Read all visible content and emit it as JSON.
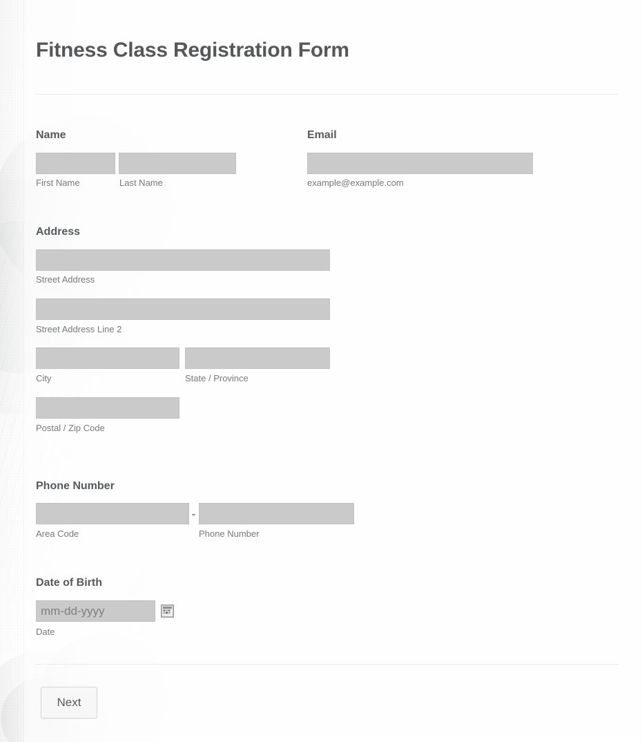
{
  "form": {
    "title": "Fitness Class Registration Form",
    "submit_label": "Next"
  },
  "fields": {
    "name": {
      "label": "Name",
      "first": {
        "sub_label": "First Name",
        "value": "",
        "placeholder": ""
      },
      "last": {
        "sub_label": "Last Name",
        "value": "",
        "placeholder": ""
      }
    },
    "email": {
      "label": "Email",
      "sub_label": "example@example.com",
      "value": "",
      "placeholder": ""
    },
    "address": {
      "label": "Address",
      "street": {
        "sub_label": "Street Address",
        "value": "",
        "placeholder": ""
      },
      "street2": {
        "sub_label": "Street Address Line 2",
        "value": "",
        "placeholder": ""
      },
      "city": {
        "sub_label": "City",
        "value": "",
        "placeholder": ""
      },
      "state": {
        "sub_label": "State / Province",
        "value": "",
        "placeholder": ""
      },
      "postal": {
        "sub_label": "Postal / Zip Code",
        "value": "",
        "placeholder": ""
      }
    },
    "phone": {
      "label": "Phone Number",
      "separator": "-",
      "area_code": {
        "sub_label": "Area Code",
        "value": "",
        "placeholder": ""
      },
      "number": {
        "sub_label": "Phone Number",
        "value": "",
        "placeholder": ""
      }
    },
    "dob": {
      "label": "Date of Birth",
      "sub_label": "Date",
      "value": "",
      "placeholder": "mm-dd-yyyy",
      "picker_icon": "calendar-icon"
    }
  },
  "colors": {
    "page_background": "#fdfdfd",
    "input_fill": "#cacaca",
    "input_border": "#c2c2c2",
    "heading_text": "#575a5c",
    "sub_label_text": "#77797b",
    "divider": "#ececec",
    "button_face": "#f7f7f7",
    "button_border": "#d6d6d6"
  }
}
